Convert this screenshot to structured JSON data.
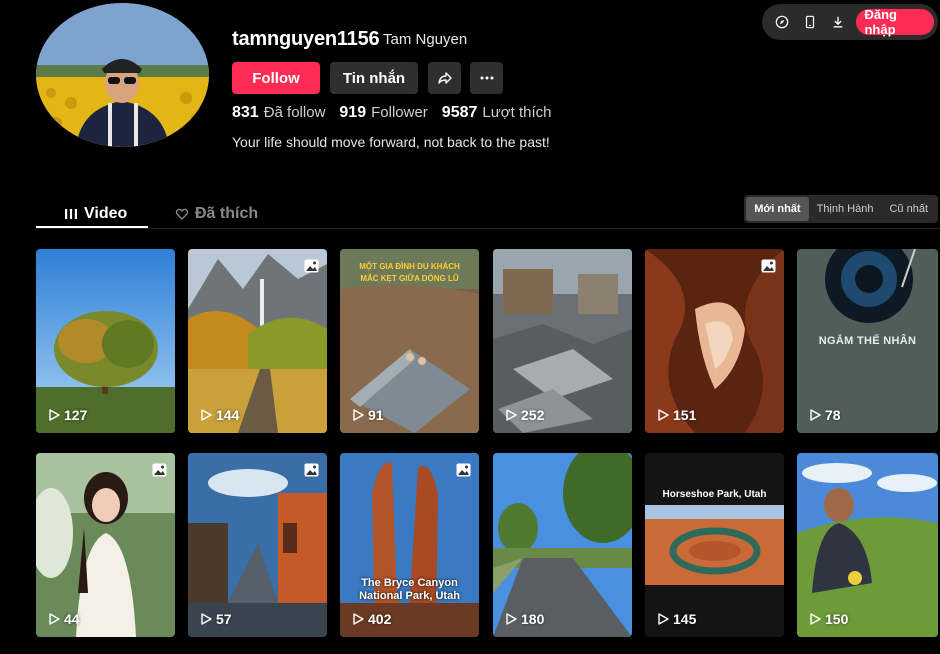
{
  "topbar": {
    "login_label": "Đăng nhập"
  },
  "profile": {
    "username": "tamnguyen1156",
    "nickname": "Tam Nguyen",
    "follow_label": "Follow",
    "message_label": "Tin nhắn",
    "following_count": "831",
    "following_label": "Đã follow",
    "followers_count": "919",
    "followers_label": "Follower",
    "likes_count": "9587",
    "likes_label": "Lượt thích",
    "bio": "Your life should move forward, not back to the past!"
  },
  "tabs": [
    {
      "label": "Video",
      "active": true
    },
    {
      "label": "Đã thích",
      "active": false
    }
  ],
  "sort_options": [
    {
      "label": "Mới nhất",
      "active": true
    },
    {
      "label": "Thịnh Hành",
      "active": false
    },
    {
      "label": "Cũ nhất",
      "active": false
    }
  ],
  "videos": [
    {
      "views": "127",
      "photo": false,
      "theme": "tree-field"
    },
    {
      "views": "144",
      "photo": true,
      "theme": "yosemite-autumn"
    },
    {
      "views": "91",
      "photo": false,
      "theme": "flood-rooftop",
      "caption_lines": [
        "MỘT GIA ĐÌNH DU KHÁCH",
        "MẮC KẸT GIỮA DÒNG LŨ"
      ]
    },
    {
      "views": "252",
      "photo": false,
      "theme": "storm-debris"
    },
    {
      "views": "151",
      "photo": true,
      "theme": "antelope-canyon"
    },
    {
      "views": "78",
      "photo": false,
      "theme": "music-disc",
      "caption": "NGẮM THẾ NHÂN"
    },
    {
      "views": "44",
      "photo": true,
      "theme": "portrait-garden"
    },
    {
      "views": "57",
      "photo": true,
      "theme": "rainy-street"
    },
    {
      "views": "402",
      "photo": true,
      "theme": "bryce-canyon",
      "caption_lines": [
        "The Bryce Canyon",
        "National Park, Utah"
      ]
    },
    {
      "views": "180",
      "photo": false,
      "theme": "suburb-road"
    },
    {
      "views": "145",
      "photo": false,
      "theme": "horseshoe",
      "caption": "Horseshoe Park, Utah"
    },
    {
      "views": "150",
      "photo": false,
      "theme": "man-meadow"
    }
  ],
  "colors": {
    "accent": "#fe2c55",
    "background": "#000000",
    "button_dark": "#2f2f2f"
  }
}
